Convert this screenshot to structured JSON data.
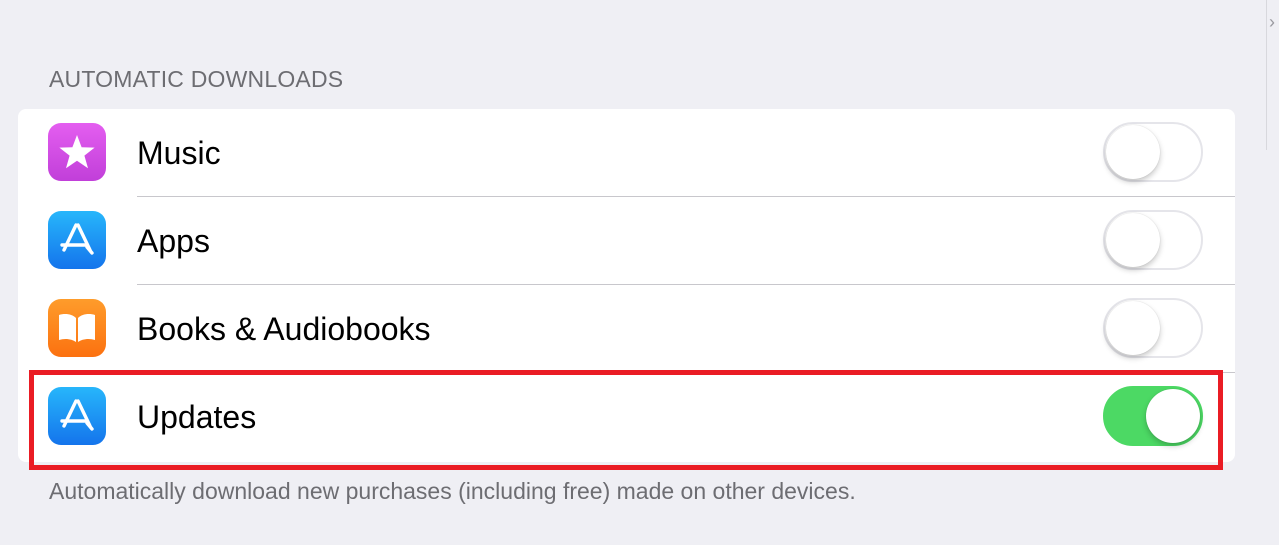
{
  "section": {
    "header": "AUTOMATIC DOWNLOADS",
    "footer": "Automatically download new purchases (including free) made on other devices."
  },
  "rows": [
    {
      "label": "Music",
      "icon": "itunes-star-icon",
      "enabled": false
    },
    {
      "label": "Apps",
      "icon": "app-store-icon",
      "enabled": false
    },
    {
      "label": "Books & Audiobooks",
      "icon": "books-icon",
      "enabled": false
    },
    {
      "label": "Updates",
      "icon": "app-store-icon",
      "enabled": true
    }
  ],
  "colors": {
    "background": "#efeff4",
    "toggle_on": "#4cd964",
    "highlight": "#ea1c24",
    "music_icon": "#d54de6",
    "app_store_icon": "#1e8ff5",
    "books_icon": "#fd861d"
  }
}
